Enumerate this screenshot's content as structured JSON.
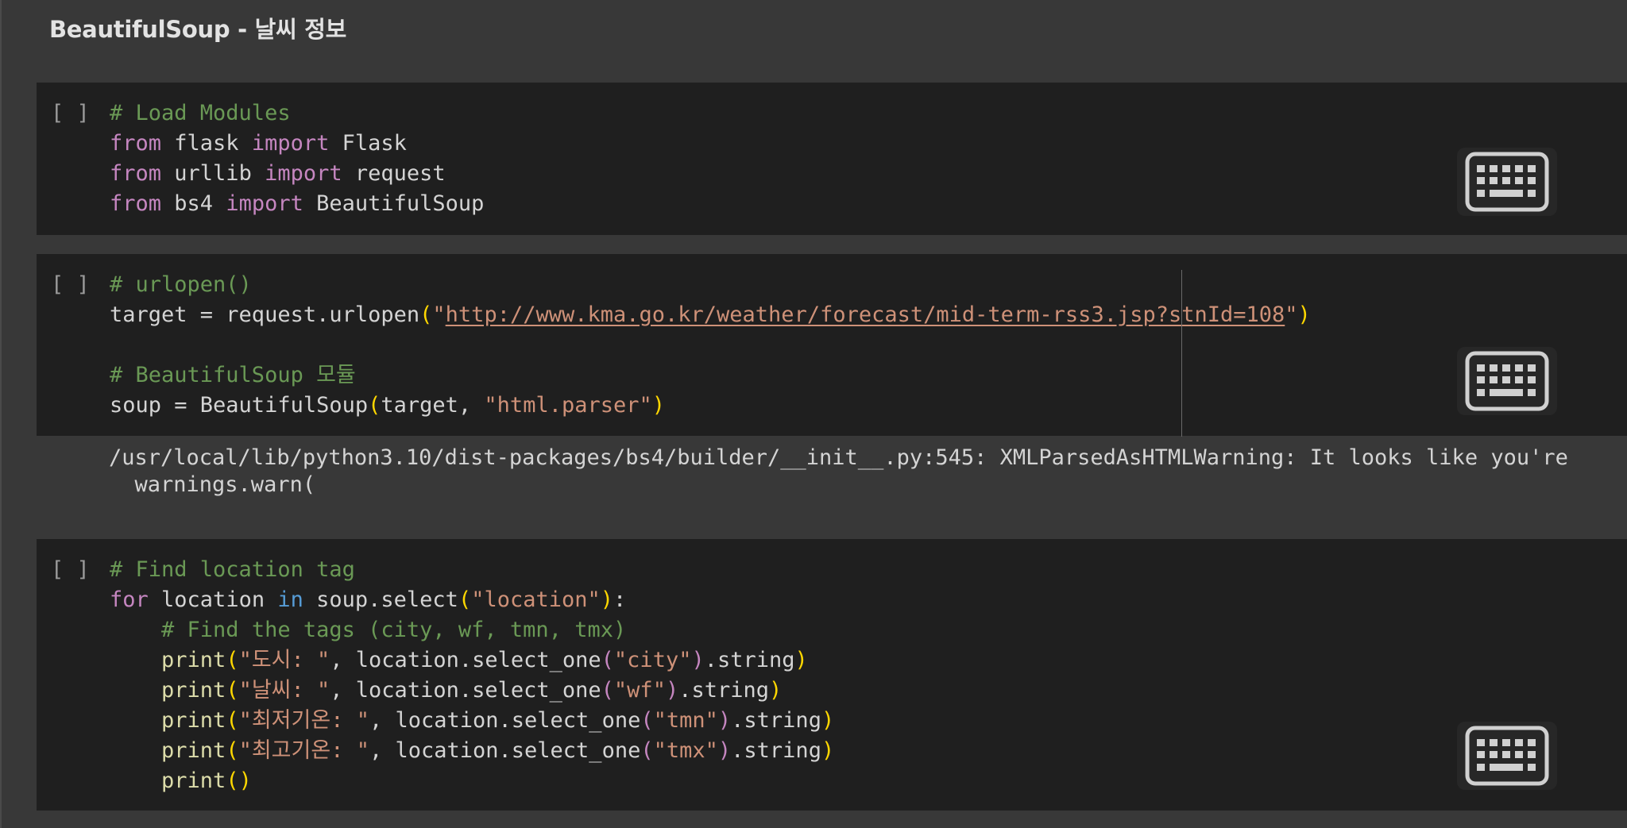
{
  "section": {
    "title": "BeautifulSoup - 날씨 정보"
  },
  "cells": [
    {
      "run_label": "[ ]",
      "lines": [
        [
          [
            "cm",
            "# Load Modules"
          ]
        ],
        [
          [
            "kw",
            "from"
          ],
          [
            "pl",
            " flask "
          ],
          [
            "kw",
            "import"
          ],
          [
            "pl",
            " Flask"
          ]
        ],
        [
          [
            "kw",
            "from"
          ],
          [
            "pl",
            " urllib "
          ],
          [
            "kw",
            "import"
          ],
          [
            "pl",
            " request"
          ]
        ],
        [
          [
            "kw",
            "from"
          ],
          [
            "pl",
            " bs4 "
          ],
          [
            "kw",
            "import"
          ],
          [
            "pl",
            " BeautifulSoup"
          ]
        ]
      ]
    },
    {
      "run_label": "[ ]",
      "lines": [
        [
          [
            "cm",
            "# urlopen()"
          ]
        ],
        [
          [
            "pl",
            "target = request.urlopen"
          ],
          [
            "br",
            "("
          ],
          [
            "st",
            "\""
          ],
          [
            "lnk",
            "http://www.kma.go.kr/weather/forecast/mid-term-rss3.jsp?stnId=108"
          ],
          [
            "st",
            "\""
          ],
          [
            "br",
            ")"
          ]
        ],
        [
          [
            "pl",
            ""
          ]
        ],
        [
          [
            "cm",
            "# BeautifulSoup 모듈"
          ]
        ],
        [
          [
            "pl",
            "soup = BeautifulSoup"
          ],
          [
            "br",
            "("
          ],
          [
            "pl",
            "target, "
          ],
          [
            "st",
            "\"html.parser\""
          ],
          [
            "br",
            ")"
          ]
        ]
      ],
      "output": [
        "/usr/local/lib/python3.10/dist-packages/bs4/builder/__init__.py:545: XMLParsedAsHTMLWarning: It looks like you're",
        "  warnings.warn("
      ]
    },
    {
      "run_label": "[ ]",
      "lines": [
        [
          [
            "cm",
            "# Find location tag"
          ]
        ],
        [
          [
            "kw",
            "for"
          ],
          [
            "pl",
            " location "
          ],
          [
            "kb",
            "in"
          ],
          [
            "pl",
            " soup.select"
          ],
          [
            "br",
            "("
          ],
          [
            "st",
            "\"location\""
          ],
          [
            "br",
            ")"
          ],
          [
            "pl",
            ":"
          ]
        ],
        [
          [
            "pl",
            "    "
          ],
          [
            "cm",
            "# Find the tags (city, wf, tmn, tmx)"
          ]
        ],
        [
          [
            "pl",
            "    "
          ],
          [
            "fn",
            "print"
          ],
          [
            "br",
            "("
          ],
          [
            "st",
            "\"도시: \""
          ],
          [
            "pl",
            ", location.select_one"
          ],
          [
            "kw",
            "("
          ],
          [
            "st",
            "\"city\""
          ],
          [
            "kw",
            ")"
          ],
          [
            "pl",
            ".string"
          ],
          [
            "br",
            ")"
          ]
        ],
        [
          [
            "pl",
            "    "
          ],
          [
            "fn",
            "print"
          ],
          [
            "br",
            "("
          ],
          [
            "st",
            "\"날씨: \""
          ],
          [
            "pl",
            ", location.select_one"
          ],
          [
            "kw",
            "("
          ],
          [
            "st",
            "\"wf\""
          ],
          [
            "kw",
            ")"
          ],
          [
            "pl",
            ".string"
          ],
          [
            "br",
            ")"
          ]
        ],
        [
          [
            "pl",
            "    "
          ],
          [
            "fn",
            "print"
          ],
          [
            "br",
            "("
          ],
          [
            "st",
            "\"최저기온: \""
          ],
          [
            "pl",
            ", location.select_one"
          ],
          [
            "kw",
            "("
          ],
          [
            "st",
            "\"tmn\""
          ],
          [
            "kw",
            ")"
          ],
          [
            "pl",
            ".string"
          ],
          [
            "br",
            ")"
          ]
        ],
        [
          [
            "pl",
            "    "
          ],
          [
            "fn",
            "print"
          ],
          [
            "br",
            "("
          ],
          [
            "st",
            "\"최고기온: \""
          ],
          [
            "pl",
            ", location.select_one"
          ],
          [
            "kw",
            "("
          ],
          [
            "st",
            "\"tmx\""
          ],
          [
            "kw",
            ")"
          ],
          [
            "pl",
            ".string"
          ],
          [
            "br",
            ")"
          ]
        ],
        [
          [
            "pl",
            "    "
          ],
          [
            "fn",
            "print"
          ],
          [
            "br",
            "()"
          ]
        ]
      ]
    }
  ],
  "icons": {
    "keyboard": "keyboard-icon"
  },
  "colors": {
    "background": "#383838",
    "cell_bg": "#1f1f1f",
    "comment": "#6a9955",
    "keyword": "#c586c0",
    "string": "#ce9178",
    "bracket": "#ffd700",
    "function": "#dcdcaa"
  }
}
